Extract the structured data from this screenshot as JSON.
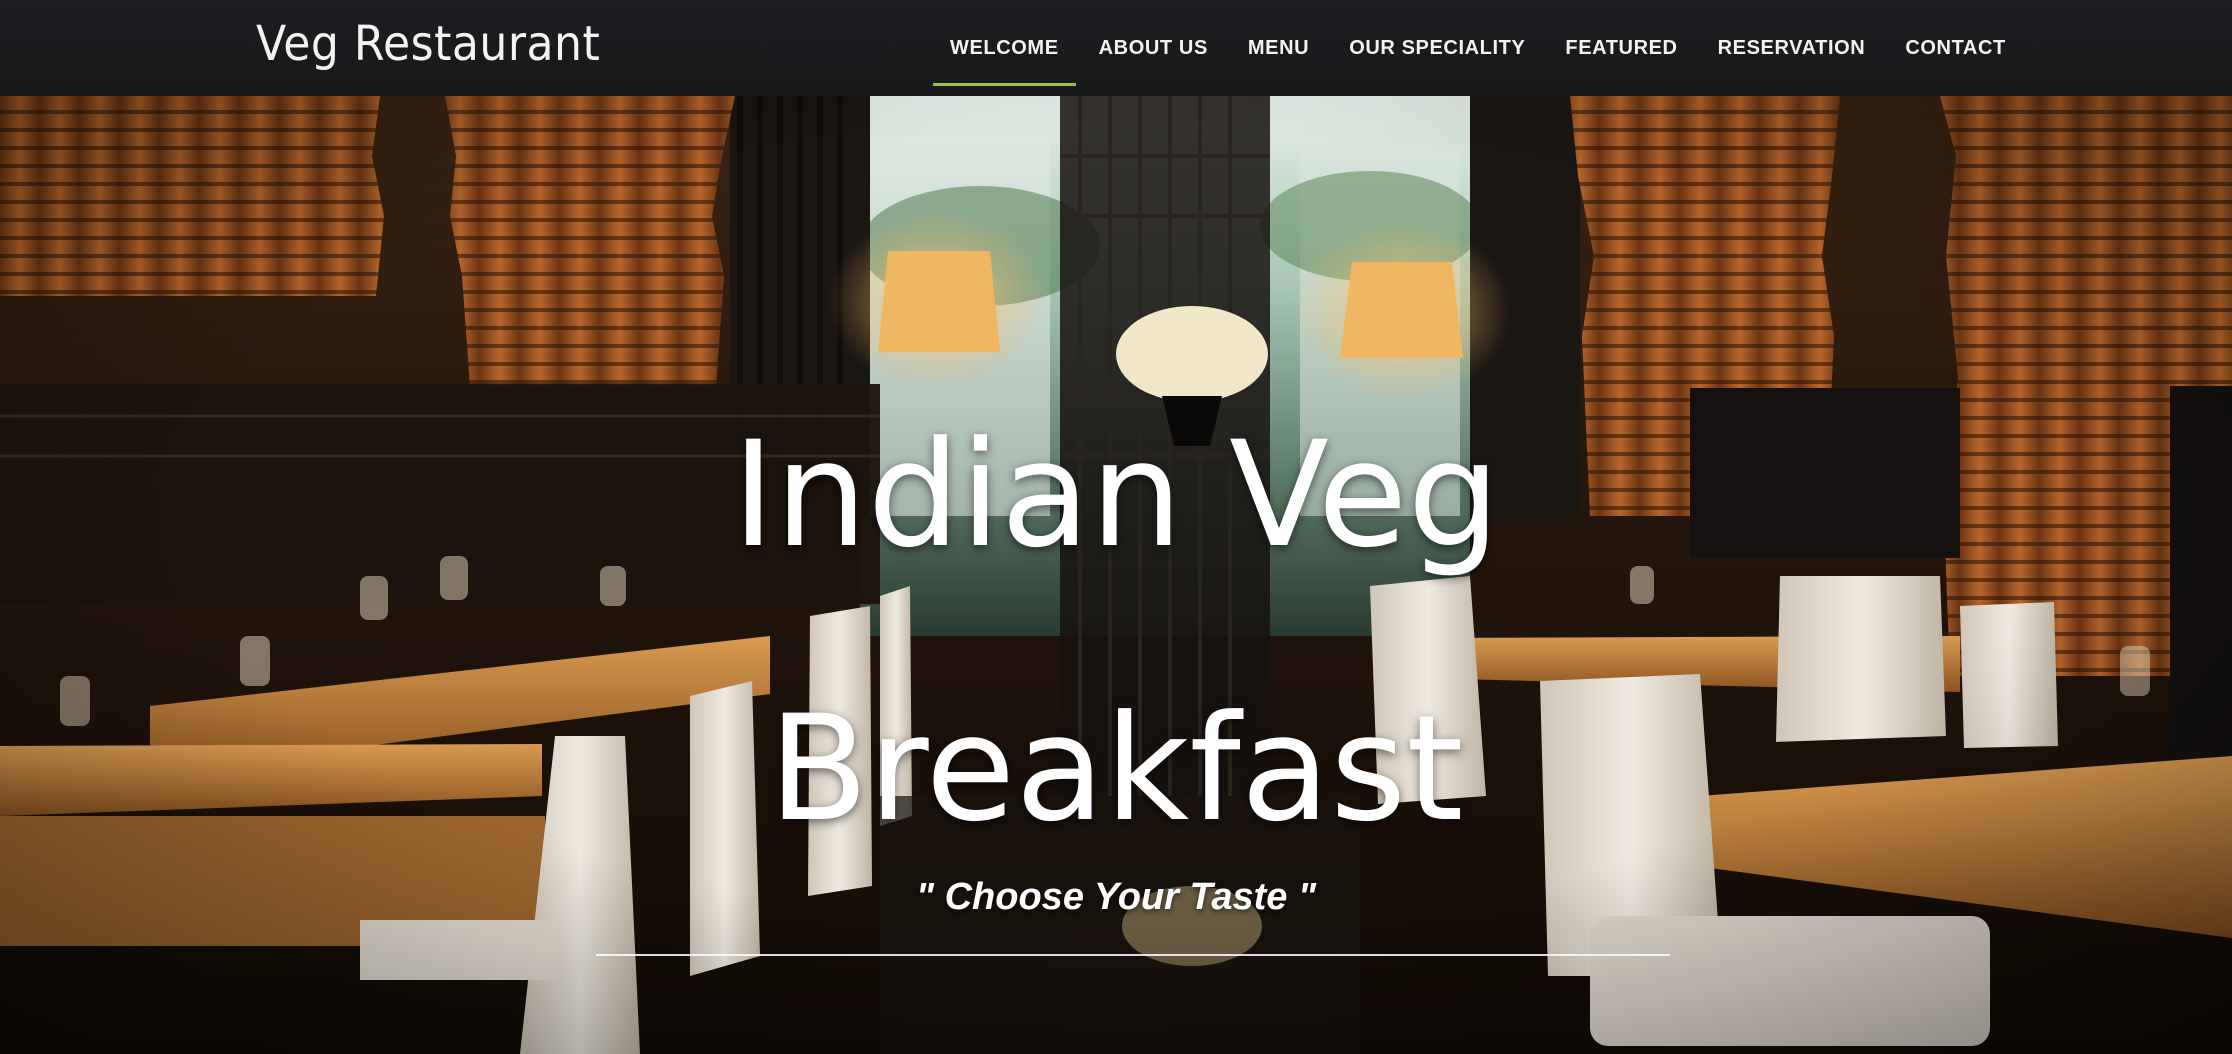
{
  "brand": {
    "name": "Veg Restaurant"
  },
  "nav": {
    "items": [
      {
        "label": "WELCOME",
        "active": true
      },
      {
        "label": "ABOUT US",
        "active": false
      },
      {
        "label": "MENU",
        "active": false
      },
      {
        "label": "OUR SPECIALITY",
        "active": false
      },
      {
        "label": "FEATURED",
        "active": false
      },
      {
        "label": "RESERVATION",
        "active": false
      },
      {
        "label": "CONTACT",
        "active": false
      }
    ]
  },
  "hero": {
    "title_line1": "Indian Veg",
    "title_line2": "Breakfast",
    "tagline": "\" Choose Your Taste \""
  },
  "colors": {
    "nav_background": "#1b1c1f",
    "active_underline": "#8fc443",
    "text": "#ffffff"
  }
}
